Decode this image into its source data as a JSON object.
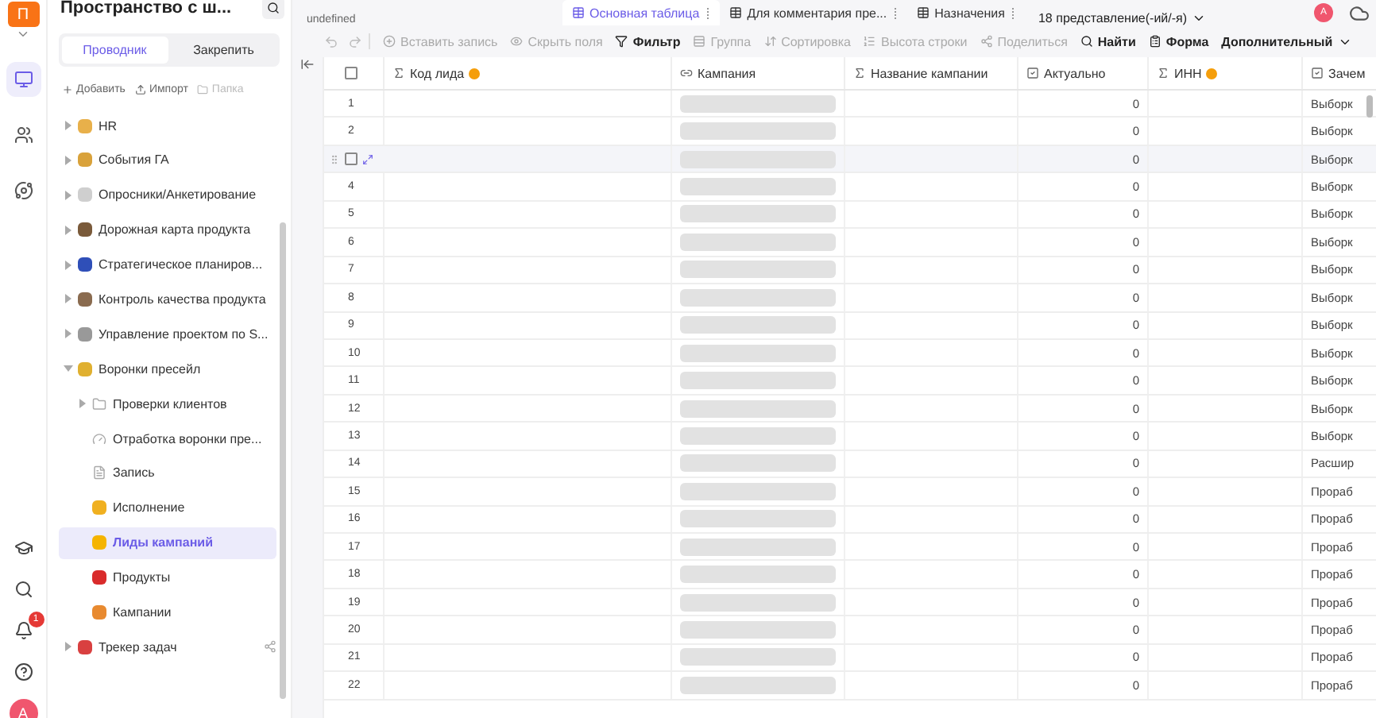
{
  "rail": {
    "logo": "П",
    "nav": [
      {
        "selected": true
      },
      {
        "selected": false
      },
      {
        "selected": false
      }
    ],
    "notifications": "1",
    "avatar": "A"
  },
  "sidebar": {
    "title": "Пространство с ш...",
    "tabs": [
      {
        "label": "Проводник",
        "selected": true
      },
      {
        "label": "Закрепить",
        "selected": false
      }
    ],
    "actions": [
      {
        "label": "Добавить",
        "disabled": false
      },
      {
        "label": "Импорт",
        "disabled": false
      },
      {
        "label": "Папка",
        "disabled": true
      }
    ],
    "tree": [
      {
        "label": "HR",
        "kind": "space",
        "expandable": true,
        "expanded": false,
        "selected": false
      },
      {
        "label": "События ГА",
        "kind": "space",
        "expandable": true,
        "expanded": false,
        "selected": false
      },
      {
        "label": "Опросники/Анкетирование",
        "kind": "space",
        "expandable": true,
        "expanded": false,
        "selected": false
      },
      {
        "label": "Дорожная карта продукта",
        "kind": "space",
        "expandable": true,
        "expanded": false,
        "selected": false
      },
      {
        "label": "Стратегическое планиров...",
        "kind": "space",
        "expandable": true,
        "expanded": false,
        "selected": false
      },
      {
        "label": "Контроль качества продукта",
        "kind": "space",
        "expandable": true,
        "expanded": false,
        "selected": false
      },
      {
        "label": "Управление проектом по S...",
        "kind": "space",
        "expandable": true,
        "expanded": false,
        "selected": false
      },
      {
        "label": "Воронки пресейл",
        "kind": "space",
        "expandable": true,
        "expanded": true,
        "selected": false,
        "children": [
          {
            "label": "Проверки клиентов",
            "kind": "folder",
            "expandable": true,
            "expanded": false,
            "selected": false
          },
          {
            "label": "Отработка воронки пре...",
            "kind": "dashboard",
            "expandable": false,
            "expanded": false,
            "selected": false
          },
          {
            "label": "Запись",
            "kind": "form",
            "expandable": false,
            "expanded": false,
            "selected": false
          },
          {
            "label": "Исполнение",
            "kind": "space",
            "expandable": false,
            "expanded": false,
            "selected": false
          },
          {
            "label": "Лиды кампаний",
            "kind": "space",
            "expandable": false,
            "expanded": false,
            "selected": true
          },
          {
            "label": "Продукты",
            "kind": "space",
            "expandable": false,
            "expanded": false,
            "selected": false
          },
          {
            "label": "Кампании",
            "kind": "space",
            "expandable": false,
            "expanded": false,
            "selected": false
          }
        ]
      },
      {
        "label": "Трекер задач",
        "kind": "space",
        "expandable": true,
        "expanded": false,
        "selected": false,
        "shared": true
      }
    ]
  },
  "header": {
    "subtitle": "undefined",
    "views": [
      {
        "label": "Основная таблица",
        "selected": true
      },
      {
        "label": "Для комментария пре...",
        "selected": false
      },
      {
        "label": "Назначения",
        "selected": false
      }
    ],
    "views_count": "18 представление(-ий/-я)",
    "avatar": "A"
  },
  "toolbar": [
    {
      "label": "Вставить запись",
      "disabled": true
    },
    {
      "label": "Скрыть поля",
      "disabled": true
    },
    {
      "label": "Фильтр",
      "disabled": false
    },
    {
      "label": "Группа",
      "disabled": true
    },
    {
      "label": "Сортировка",
      "disabled": true
    },
    {
      "label": "Высота строки",
      "disabled": true
    },
    {
      "label": "Поделиться",
      "disabled": true
    },
    {
      "label": "Найти",
      "disabled": false
    },
    {
      "label": "Форма",
      "disabled": false
    },
    {
      "label": "Дополнительный",
      "disabled": false
    }
  ],
  "table": {
    "all_checked": false,
    "columns": [
      {
        "label": "Код лида",
        "warning": true
      },
      {
        "label": "Кампания",
        "warning": false
      },
      {
        "label": "Название кампании",
        "warning": false
      },
      {
        "label": "Актуально",
        "warning": false
      },
      {
        "label": "ИНН",
        "warning": true
      },
      {
        "label": "Зачем",
        "warning": false
      }
    ],
    "rows": [
      {
        "number": "1",
        "hovered": false,
        "loading": true,
        "actual": "0",
        "reason": "Выборк"
      },
      {
        "number": "2",
        "hovered": false,
        "loading": true,
        "actual": "0",
        "reason": "Выборк"
      },
      {
        "hovered": true,
        "checked": false,
        "loading": true,
        "actual": "0",
        "reason": "Выборк"
      },
      {
        "number": "4",
        "hovered": false,
        "loading": true,
        "actual": "0",
        "reason": "Выборк"
      },
      {
        "number": "5",
        "hovered": false,
        "loading": true,
        "actual": "0",
        "reason": "Выборк"
      },
      {
        "number": "6",
        "hovered": false,
        "loading": true,
        "actual": "0",
        "reason": "Выборк"
      },
      {
        "number": "7",
        "hovered": false,
        "loading": true,
        "actual": "0",
        "reason": "Выборк"
      },
      {
        "number": "8",
        "hovered": false,
        "loading": true,
        "actual": "0",
        "reason": "Выборк"
      },
      {
        "number": "9",
        "hovered": false,
        "loading": true,
        "actual": "0",
        "reason": "Выборк"
      },
      {
        "number": "10",
        "hovered": false,
        "loading": true,
        "actual": "0",
        "reason": "Выборк"
      },
      {
        "number": "11",
        "hovered": false,
        "loading": true,
        "actual": "0",
        "reason": "Выборк"
      },
      {
        "number": "12",
        "hovered": false,
        "loading": true,
        "actual": "0",
        "reason": "Выборк"
      },
      {
        "number": "13",
        "hovered": false,
        "loading": true,
        "actual": "0",
        "reason": "Выборк"
      },
      {
        "number": "14",
        "hovered": false,
        "loading": true,
        "actual": "0",
        "reason": "Расшир"
      },
      {
        "number": "15",
        "hovered": false,
        "loading": true,
        "actual": "0",
        "reason": "Прораб"
      },
      {
        "number": "16",
        "hovered": false,
        "loading": true,
        "actual": "0",
        "reason": "Прораб"
      },
      {
        "number": "17",
        "hovered": false,
        "loading": true,
        "actual": "0",
        "reason": "Прораб"
      },
      {
        "number": "18",
        "hovered": false,
        "loading": true,
        "actual": "0",
        "reason": "Прораб"
      },
      {
        "number": "19",
        "hovered": false,
        "loading": true,
        "actual": "0",
        "reason": "Прораб"
      },
      {
        "number": "20",
        "hovered": false,
        "loading": true,
        "actual": "0",
        "reason": "Прораб"
      },
      {
        "number": "21",
        "hovered": false,
        "loading": true,
        "actual": "0",
        "reason": "Прораб"
      },
      {
        "number": "22",
        "hovered": false,
        "loading": true,
        "actual": "0",
        "reason": "Прораб"
      }
    ]
  }
}
